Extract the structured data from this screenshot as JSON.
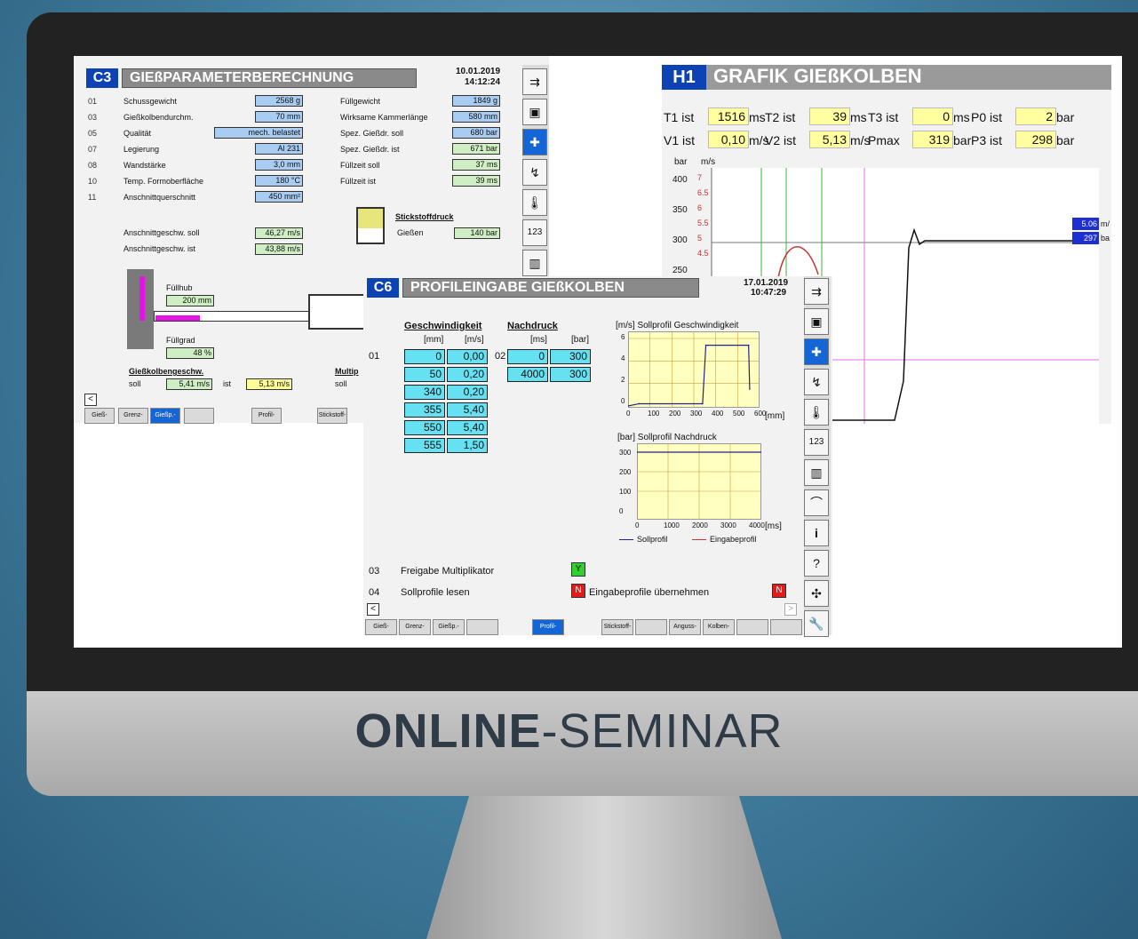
{
  "banner": {
    "bold": "ONLINE",
    "rest": "-SEMINAR"
  },
  "c3": {
    "code": "C3",
    "title": "GIEßPARAMETERBERECHNUNG",
    "date": "10.01.2019",
    "time": "14:12:24",
    "rows": [
      {
        "nr": "01",
        "label": "Schussgewicht",
        "value": "2568 g"
      },
      {
        "nr": "03",
        "label": "Gießkolbendurchm.",
        "value": "70 mm"
      },
      {
        "nr": "05",
        "label": "Qualität",
        "value": "mech. belastet"
      },
      {
        "nr": "07",
        "label": "Legierung",
        "value": "Al 231"
      },
      {
        "nr": "08",
        "label": "Wandstärke",
        "value": "3,0 mm"
      },
      {
        "nr": "10",
        "label": "Temp. Formoberfläche",
        "value": "180 °C"
      },
      {
        "nr": "11",
        "label": "Anschnittquerschnitt",
        "value": "450 mm²"
      }
    ],
    "right": [
      {
        "label": "Füllgewicht",
        "value": "1849 g"
      },
      {
        "label": "Wirksame Kammerlänge",
        "value": "580 mm"
      },
      {
        "label": "Spez. Gießdr. soll",
        "value": "680 bar"
      },
      {
        "label": "Spez. Gießdr. ist",
        "value": "671 bar"
      },
      {
        "label": "Füllzeit soll",
        "value": "37 ms"
      },
      {
        "label": "Füllzeit ist",
        "value": "39 ms"
      }
    ],
    "ansch_soll_label": "Anschnittgeschw. soll",
    "ansch_soll": "46,27 m/s",
    "ansch_ist_label": "Anschnittgeschw. ist",
    "ansch_ist": "43,88 m/s",
    "stick_title": "Stickstoffdruck",
    "stick_label": "Gießen",
    "stick_value": "140 bar",
    "fuellhub_label": "Füllhub",
    "fuellhub": "200 mm",
    "fuellgrad_label": "Füllgrad",
    "fuellgrad": "48 %",
    "kolben_title": "Gießkolbengeschw.",
    "soll_label": "soll",
    "kolben_soll": "5,41 m/s",
    "ist_label": "ist",
    "kolben_ist": "5,13 m/s",
    "multi_title": "Multip",
    "multi_soll": "soll",
    "tabs": [
      "Gieß-",
      "Grenz-",
      "Gießp.-",
      "",
      "Profil-",
      "Stickstoff-"
    ]
  },
  "h1": {
    "code": "H1",
    "title": "GRAFIK GIEßKOLBEN",
    "row1": [
      {
        "label": "T1 ist",
        "value": "1516",
        "unit": "ms"
      },
      {
        "label": "T2 ist",
        "value": "39",
        "unit": "ms"
      },
      {
        "label": "T3 ist",
        "value": "0",
        "unit": "ms"
      },
      {
        "label": "P0 ist",
        "value": "2",
        "unit": "bar"
      }
    ],
    "row2": [
      {
        "label": "V1 ist",
        "value": "0,10",
        "unit": "m/s"
      },
      {
        "label": "V2 ist",
        "value": "5,13",
        "unit": "m/s"
      },
      {
        "label": "Pmax",
        "value": "319",
        "unit": "bar"
      },
      {
        "label": "P3 ist",
        "value": "298",
        "unit": "bar"
      }
    ],
    "unit_bar": "bar",
    "unit_ms": "m/s",
    "bar_ticks": [
      "400",
      "350",
      "300",
      "250"
    ],
    "ms_ticks": [
      "7",
      "6.5",
      "6",
      "5.5",
      "5",
      "4.5"
    ],
    "cursor_v": "5.06",
    "cursor_v_unit": "m/",
    "cursor_p": "297",
    "cursor_p_unit": "ba"
  },
  "c6": {
    "code": "C6",
    "title": "PROFILEINGABE GIEßKOLBEN",
    "date": "17.01.2019",
    "time": "10:47:29",
    "geschw_title": "Geschwindigkeit",
    "nach_title": "Nachdruck",
    "col_mm": "[mm]",
    "col_ms": "[m/s]",
    "col_ms2": "[ms]",
    "col_bar": "[bar]",
    "row01": "01",
    "row02": "02",
    "geschw": [
      [
        "0",
        "0,00"
      ],
      [
        "50",
        "0,20"
      ],
      [
        "340",
        "0,20"
      ],
      [
        "355",
        "5,40"
      ],
      [
        "550",
        "5,40"
      ],
      [
        "555",
        "1,50"
      ]
    ],
    "nach": [
      [
        "0",
        "300"
      ],
      [
        "4000",
        "300"
      ]
    ],
    "chart1_title": "[m/s] Sollprofil Geschwindigkeit",
    "chart1_x": [
      "0",
      "100",
      "200",
      "300",
      "400",
      "500",
      "600"
    ],
    "chart1_xunit": "[mm]",
    "chart1_y": [
      "6",
      "4",
      "2",
      "0"
    ],
    "chart2_title": "[bar] Sollprofil Nachdruck",
    "chart2_x": [
      "0",
      "1000",
      "2000",
      "3000",
      "4000"
    ],
    "chart2_xunit": "[ms]",
    "chart2_y": [
      "300",
      "200",
      "100",
      "0"
    ],
    "legend_soll": "Sollprofil",
    "legend_eingabe": "Eingabeprofil",
    "opt03": "03",
    "opt03_label": "Freigabe Multiplikator",
    "opt03_flag": "Y",
    "opt04": "04",
    "opt04_label": "Sollprofile lesen",
    "opt04_flag": "N",
    "uebern_label": "Eingabeprofile übernehmen",
    "uebern_flag": "N",
    "tabs": [
      "Gieß-",
      "Grenz-",
      "Gießp.-",
      "",
      "Profil-",
      "Stickstoff-",
      "",
      "Anguss-",
      "Kolben-",
      "",
      ""
    ]
  },
  "chart_data": {
    "type": "line",
    "title": "[m/s] Sollprofil Geschwindigkeit",
    "xlabel": "[mm]",
    "ylabel": "[m/s]",
    "series": [
      {
        "name": "Sollprofil",
        "x": [
          0,
          50,
          340,
          355,
          550,
          555
        ],
        "y": [
          0,
          0.2,
          0.2,
          5.4,
          5.4,
          1.5
        ]
      }
    ],
    "xlim": [
      0,
      600
    ],
    "ylim": [
      0,
      6
    ]
  }
}
